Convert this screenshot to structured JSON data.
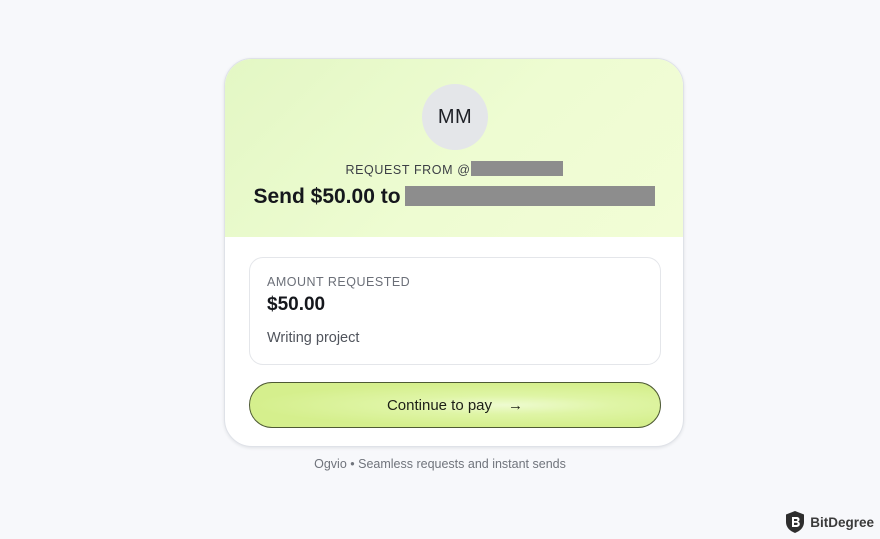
{
  "request": {
    "avatar_initials": "MM",
    "request_from_label": "REQUEST FROM @",
    "send_title": "Send $50.00 to"
  },
  "amount": {
    "label": "AMOUNT REQUESTED",
    "value": "$50.00",
    "note": "Writing project"
  },
  "action": {
    "pay_label": "Continue to pay",
    "pay_icon": "arrow-right-icon"
  },
  "footer": {
    "tagline": "Ogvio • Seamless requests and instant sends"
  },
  "watermark": {
    "text": "BitDegree"
  },
  "colors": {
    "hero_bg": "#eefcd2",
    "button_bg": "#d5ef8d",
    "page_bg": "#f7f8fb"
  }
}
